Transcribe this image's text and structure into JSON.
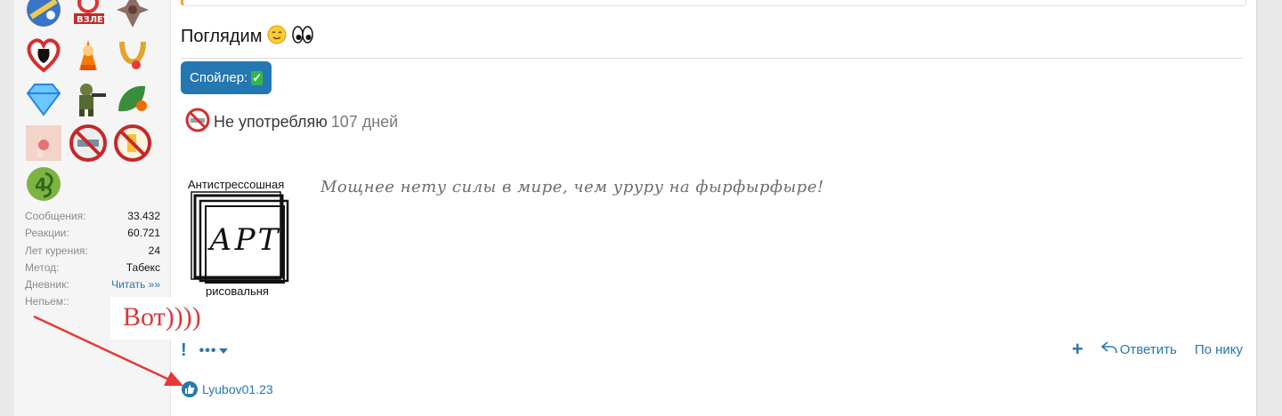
{
  "post": {
    "text": "Поглядим",
    "text_emojis": [
      "smiling-face-emoji",
      "eyes-emoji"
    ],
    "spoiler_label": "Спойлер:",
    "counter_label": "Не употребляю",
    "counter_value": "107 дней",
    "signature": {
      "art_top": "Антистрессошная",
      "art_center": "АРТ",
      "art_bottom": "рисовальня",
      "quote": "Мощнее нету силы в мире, чем урурy на фырфырфыре!"
    }
  },
  "sidebar": {
    "trophies": [
      "globe-trophy-icon",
      "takeoff-trophy-icon",
      "bird-trophy-icon",
      "heart-trophy-icon",
      "fox-trophy-icon",
      "horseshoe-trophy-icon",
      "diamond-trophy-icon",
      "soldier-trophy-icon",
      "leaf-trophy-icon",
      "hands-trophy-icon",
      "no-smoking-trophy-icon",
      "no-drink-trophy-icon",
      "level-four-trophy-icon"
    ],
    "stats": [
      {
        "label": "Сообщения:",
        "value": "33.432"
      },
      {
        "label": "Реакции:",
        "value": "60.721"
      },
      {
        "label": "Лет курения:",
        "value": "24"
      },
      {
        "label": "Метод:",
        "value": "Табекс"
      },
      {
        "label": "Дневник:",
        "value": "Читать »»"
      },
      {
        "label": "Непьем::",
        "value": "»»»"
      }
    ]
  },
  "annotation": {
    "text": "Вот))))",
    "color": "#d9383a"
  },
  "actions": {
    "report": "!",
    "more": "•••",
    "reply": "Ответить",
    "by_nick": "По нику"
  },
  "reactions": {
    "users": "Lyubov01.23"
  },
  "colors": {
    "accent": "#2577b1",
    "success": "#35b64a"
  }
}
